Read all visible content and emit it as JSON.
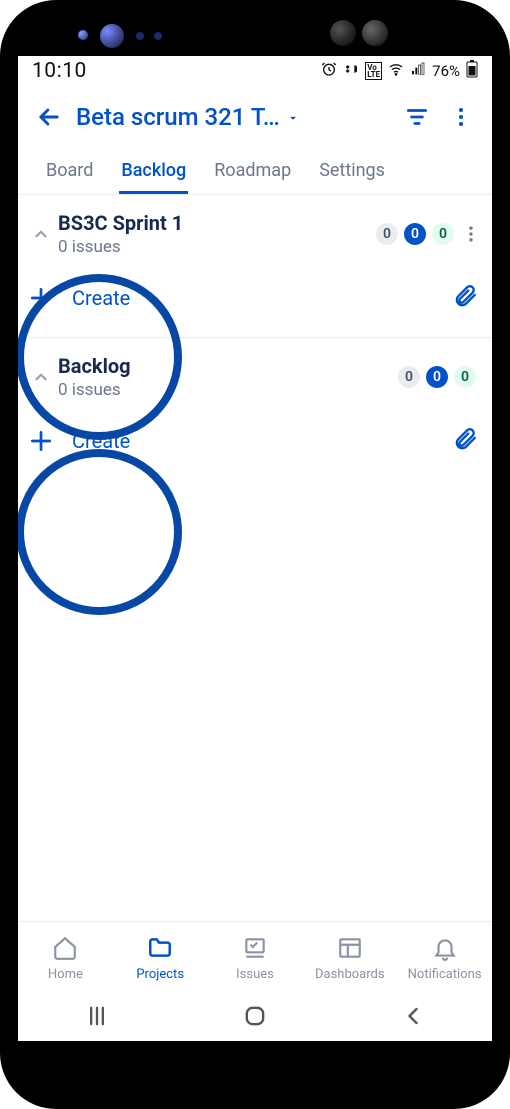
{
  "status": {
    "time": "10:10",
    "battery_text": "76%"
  },
  "header": {
    "title": "Beta scrum 321 T…"
  },
  "tabs": [
    {
      "label": "Board"
    },
    {
      "label": "Backlog",
      "active": true
    },
    {
      "label": "Roadmap"
    },
    {
      "label": "Settings"
    }
  ],
  "sections": [
    {
      "name": "BS3C Sprint 1",
      "subtext": "0 issues",
      "counts": {
        "todo": "0",
        "inprogress": "0",
        "done": "0"
      },
      "create_label": "Create",
      "show_overflow": true
    },
    {
      "name": "Backlog",
      "subtext": "0 issues",
      "counts": {
        "todo": "0",
        "inprogress": "0",
        "done": "0"
      },
      "create_label": "Create",
      "show_overflow": false
    }
  ],
  "bottom_nav": [
    {
      "label": "Home"
    },
    {
      "label": "Projects",
      "active": true
    },
    {
      "label": "Issues"
    },
    {
      "label": "Dashboards"
    },
    {
      "label": "Notifications"
    }
  ],
  "accent_color": "#0052cc"
}
